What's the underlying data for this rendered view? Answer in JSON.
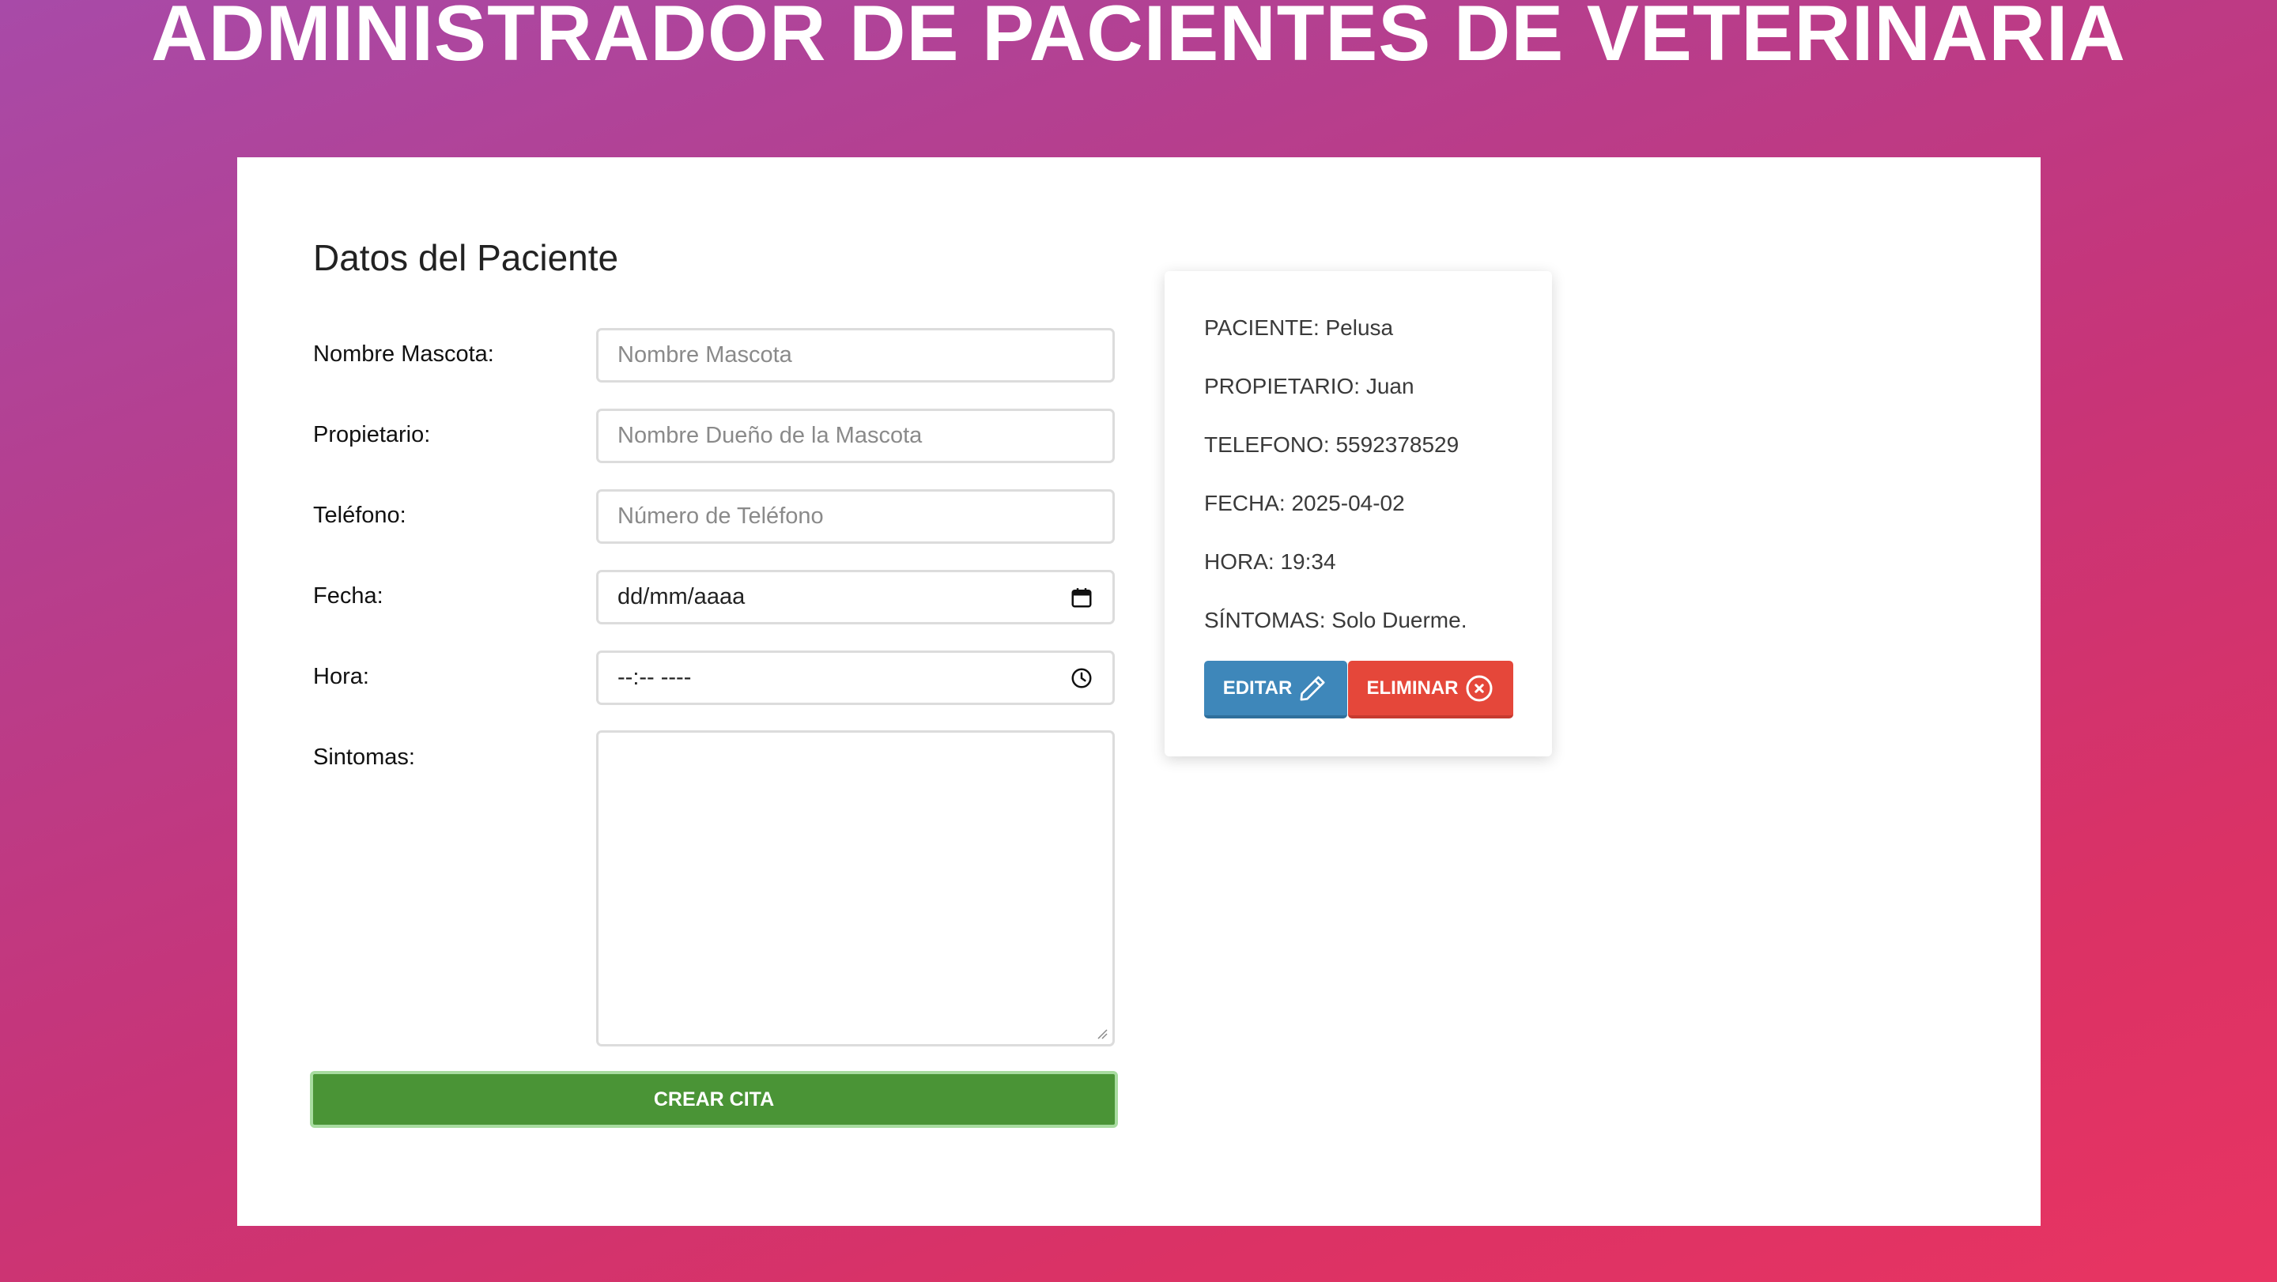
{
  "header": {
    "title": "ADMINISTRADOR DE PACIENTES DE VETERINARIA"
  },
  "form": {
    "title": "Datos del Paciente",
    "fields": {
      "pet_name": {
        "label": "Nombre Mascota:",
        "placeholder": "Nombre Mascota",
        "value": ""
      },
      "owner": {
        "label": "Propietario:",
        "placeholder": "Nombre Dueño de la Mascota",
        "value": ""
      },
      "phone": {
        "label": "Teléfono:",
        "placeholder": "Número de Teléfono",
        "value": ""
      },
      "date": {
        "label": "Fecha:",
        "display": "dd/mm/aaaa",
        "icon": "calendar-icon"
      },
      "time": {
        "label": "Hora:",
        "display": "--:-- ----",
        "icon": "clock-icon"
      },
      "symptoms": {
        "label": "Sintomas:",
        "value": ""
      }
    },
    "submit_label": "CREAR CITA"
  },
  "appointment": {
    "patient": "PACIENTE: Pelusa",
    "owner": "PROPIETARIO: Juan",
    "phone": "TELEFONO: 5592378529",
    "date": "FECHA: 2025-04-02",
    "time": "HORA: 19:34",
    "symptoms": "SÍNTOMAS: Solo Duerme.",
    "edit_label": "EDITAR",
    "edit_icon": "pencil-icon",
    "delete_label": "ELIMINAR",
    "delete_icon": "x-circle-icon"
  },
  "colors": {
    "background_start": "#a84aa8",
    "background_end": "#e83462",
    "submit_button": "#4a9436",
    "edit_button": "#3e87ba",
    "delete_button": "#e5473a"
  }
}
